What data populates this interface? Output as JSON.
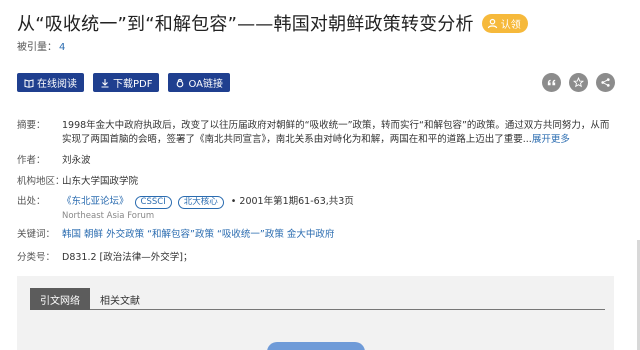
{
  "paper": {
    "title": "从“吸收统一”到“和解包容”——韩国对朝鲜政策转变分析",
    "auth_badge": "认领",
    "cited_label": "被引量：",
    "cited_count": "4"
  },
  "actions": {
    "read_online": "在线阅读",
    "download_pdf": "下载PDF",
    "oa_link": "OA链接"
  },
  "tools": [
    "quote-icon",
    "star-icon",
    "share-icon"
  ],
  "meta": {
    "abstract_label": "摘要：",
    "abstract_line1": "1998年金大中政府执政后，改变了以往历届政府对朝鲜的“吸收统一”政策，转而实行“和解包容”的政策。通过双方共同努力，从而",
    "abstract_line2": "实现了两国首脑的会晤，签署了《南北共同宣言》，南北关系由对峙化为和解，两国在和平的道路上迈出了重要...",
    "abstract_more": "展开更多",
    "author_label": "作者：",
    "author": "刘永波",
    "org_label": "机构地区：",
    "org": "山东大学国政学院",
    "source_label": "出处：",
    "journal": "《东北亚论坛》",
    "tag1": "CSSCI",
    "tag2": "北大核心",
    "issue": "•  2001年第1期61-63,共3页",
    "journal_en": "Northeast Asia Forum",
    "keywords_label": "关键词：",
    "keywords": [
      "韩国",
      "朝鲜",
      "外交政策",
      "“和解包容”政策",
      "“吸收统一”政策",
      "金大中政府"
    ],
    "class_label": "分类号：",
    "class": "D831.2 [政治法律—外交学]；"
  },
  "tabs": [
    "引文网络",
    "相关文献"
  ],
  "colors": {
    "primary": "#1f3f8f",
    "badge": "#f6b93b",
    "link": "#2b6cb0"
  }
}
